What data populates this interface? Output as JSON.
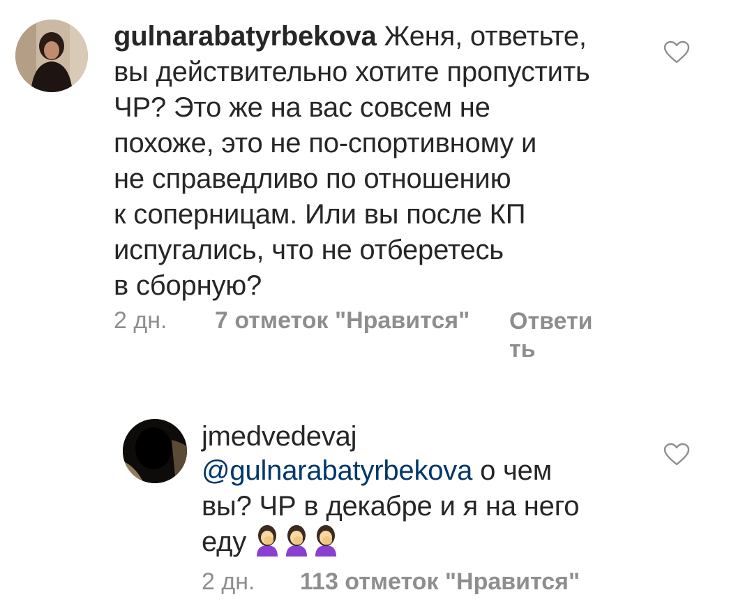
{
  "comments": [
    {
      "username": "gulnarabatyrbekova",
      "text_lines": [
        " Женя, ответьте,",
        "вы действительно хотите пропустить",
        "ЧР? Это же на вас совсем не",
        "похоже, это не по-спортивному и",
        "не справедливо по отношению",
        "к соперницам. Или вы после КП",
        "испугались, что не отберетесь",
        "в сборную?"
      ],
      "time": "2 дн.",
      "likes": "7 отметок \"Нравится\"",
      "reply_line1": "Ответи",
      "reply_line2": "ть",
      "like_icon": "heart-outline-icon"
    },
    {
      "username": "jmedvedevaj",
      "mention": "@gulnarabatyrbekova",
      "text_after_mention": " о чем",
      "text_line2": "вы? ЧР в декабре и я на него",
      "text_line3": "еду",
      "emojis": [
        "woman-facepalming-emoji",
        "woman-facepalming-emoji",
        "woman-facepalming-emoji"
      ],
      "time": "2 дн.",
      "likes": "113 отметок \"Нравится\"",
      "like_icon": "heart-outline-icon"
    }
  ],
  "colors": {
    "text": "#262626",
    "muted": "#8e8e8e",
    "mention": "#00376b",
    "emoji_hair": "#3a2a22",
    "emoji_skin": "#f7d9a0",
    "emoji_shirt": "#8a3fd0"
  }
}
